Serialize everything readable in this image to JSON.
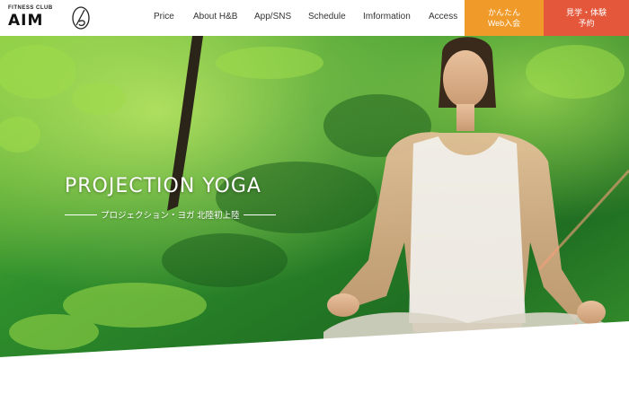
{
  "header": {
    "logo_small": "FITNESS CLUB",
    "logo_big": "AIM",
    "nav": [
      {
        "label": "Price"
      },
      {
        "label": "About H&B"
      },
      {
        "label": "App/SNS"
      },
      {
        "label": "Schedule"
      },
      {
        "label": "Imformation"
      },
      {
        "label": "Access"
      }
    ],
    "join_button": {
      "line1": "かんたん",
      "line2": "Web入会"
    },
    "trial_button": {
      "line1": "見学・体験",
      "line2": "予約"
    }
  },
  "hero": {
    "title": "PROJECTION YOGA",
    "subtitle": "プロジェクション・ヨガ 北陸初上陸"
  },
  "colors": {
    "join": "#f09a2a",
    "trial": "#e4573b",
    "forest": "#2f8a2a"
  }
}
